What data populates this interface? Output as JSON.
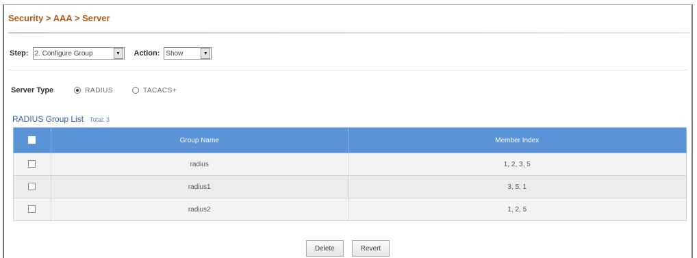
{
  "header": {
    "breadcrumb": "Security > AAA > Server"
  },
  "controls": {
    "step_label": "Step:",
    "step_value": "2. Configure Group",
    "action_label": "Action:",
    "action_value": "Show"
  },
  "server_type": {
    "label": "Server Type",
    "options": [
      {
        "label": "RADIUS",
        "selected": true
      },
      {
        "label": "TACACS+",
        "selected": false
      }
    ]
  },
  "group_list": {
    "title": "RADIUS Group List",
    "total": "Total: 3",
    "columns": [
      "Group Name",
      "Member Index"
    ],
    "rows": [
      {
        "group_name": "radius",
        "member_index": "1, 2, 3, 5"
      },
      {
        "group_name": "radius1",
        "member_index": "3, 5, 1"
      },
      {
        "group_name": "radius2",
        "member_index": "1, 2, 5"
      }
    ]
  },
  "buttons": {
    "delete": "Delete",
    "revert": "Revert"
  },
  "colors": {
    "breadcrumb": "#b05a14",
    "table_header": "#5a93d6",
    "list_title": "#315db0"
  }
}
